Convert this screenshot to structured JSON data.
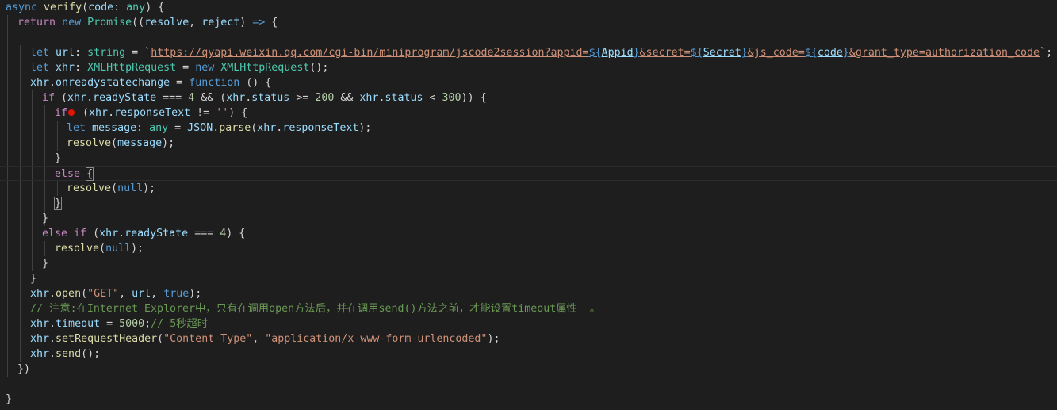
{
  "editor": {
    "background": "#1e1e1e",
    "language": "typescript",
    "breakpoint_color": "#e51400",
    "lines": {
      "l1": {
        "kw_async": "async",
        "fn_verify": "verify",
        "open": "(",
        "param": "code",
        "colon": ": ",
        "type_any": "any",
        "close": ") {"
      },
      "l2": {
        "kw_return": "return",
        "kw_new": "new",
        "ty_promise": "Promise",
        "open": "((",
        "p_resolve": "resolve",
        "comma": ", ",
        "p_reject": "reject",
        "close": ") ",
        "arrow": "=>",
        "brace": " {"
      },
      "l4": {
        "kw_let": "let",
        "v_url": "url",
        "colon": ": ",
        "ty_string": "string",
        "eq": " = ",
        "bt_open": "`",
        "url_part1": "https://qyapi.weixin.qq.com/cgi-bin/miniprogram/jscode2session?appid=",
        "tpl1_open": "${",
        "tpl1_var": "Appid",
        "tpl1_close": "}",
        "url_part2": "&secret=",
        "tpl2_open": "${",
        "tpl2_var": "Secret",
        "tpl2_close": "}",
        "url_part3": "&js_code=",
        "tpl3_open": "${",
        "tpl3_var": "code",
        "tpl3_close": "}",
        "url_part4": "&grant_type=authorization_code",
        "bt_close": "`",
        "semi": ";"
      },
      "l5": {
        "kw_let": "let",
        "v_xhr": "xhr",
        "colon": ": ",
        "ty_xhr": "XMLHttpRequest",
        "eq": " = ",
        "kw_new": "new",
        "ty_ctor": "XMLHttpRequest",
        "tail": "();"
      },
      "l6": {
        "v_xhr": "xhr",
        "dot": ".",
        "prop": "onreadystatechange",
        "eq": " = ",
        "kw_function": "function",
        "tail": " () {"
      },
      "l7": {
        "kw_if": "if",
        "a": " (",
        "v1": "xhr",
        "d1": ".",
        "p1": "readyState",
        "op1": " === ",
        "n1": "4",
        "and1": " && (",
        "v2": "xhr",
        "d2": ".",
        "p2": "status",
        "op2": " >= ",
        "n2": "200",
        "and2": " && ",
        "v3": "xhr",
        "d3": ".",
        "p3": "status",
        "op3": " < ",
        "n3": "300",
        "tail": ")) {"
      },
      "l8": {
        "kw_if": "if",
        "a": " (",
        "v": "xhr",
        "d": ".",
        "p": "responseText",
        "op": " != ",
        "s": "''",
        "tail": ") {"
      },
      "l9": {
        "kw_let": "let",
        "v_msg": "message",
        "colon": ": ",
        "ty_any": "any",
        "eq": " = ",
        "v_json": "JSON",
        "d": ".",
        "fn_parse": "parse",
        "open": "(",
        "v_xhr": "xhr",
        "d2": ".",
        "p": "responseText",
        "tail": ");"
      },
      "l10": {
        "fn": "resolve",
        "open": "(",
        "v": "message",
        "tail": ");"
      },
      "l11": {
        "brace": "}"
      },
      "l12": {
        "kw_else": "else",
        "sp": " ",
        "brace": "{"
      },
      "l13": {
        "fn": "resolve",
        "open": "(",
        "kw_null": "null",
        "tail": ");"
      },
      "l14": {
        "brace": "}"
      },
      "l15": {
        "brace": "}"
      },
      "l16": {
        "kw_else": "else",
        "kw_if": "if",
        "a": " (",
        "v": "xhr",
        "d": ".",
        "p": "readyState",
        "op": " === ",
        "n": "4",
        "tail": ") {"
      },
      "l17": {
        "fn": "resolve",
        "open": "(",
        "kw_null": "null",
        "tail": ");"
      },
      "l18": {
        "brace": "}"
      },
      "l19": {
        "brace": "}"
      },
      "l20": {
        "v": "xhr",
        "d": ".",
        "fn": "open",
        "open": "(",
        "s": "\"GET\"",
        "c1": ", ",
        "v_url": "url",
        "c2": ", ",
        "kw_true": "true",
        "tail": ");"
      },
      "l21": {
        "comment": "// 注意:在Internet Explorer中，只有在调用open方法后，并在调用send()方法之前，才能设置timeout属性  。"
      },
      "l22": {
        "v": "xhr",
        "d": ".",
        "p": "timeout",
        "eq": " = ",
        "n": "5000",
        "semi": ";",
        "comment": "// 5秒超时"
      },
      "l23": {
        "v": "xhr",
        "d": ".",
        "fn": "setRequestHeader",
        "open": "(",
        "s1": "\"Content-Type\"",
        "c": ", ",
        "s2": "\"application/x-www-form-urlencoded\"",
        "tail": ");"
      },
      "l24": {
        "v": "xhr",
        "d": ".",
        "fn": "send",
        "tail": "();"
      },
      "l25": {
        "close": "})"
      },
      "l27": {
        "brace": "}"
      }
    }
  }
}
